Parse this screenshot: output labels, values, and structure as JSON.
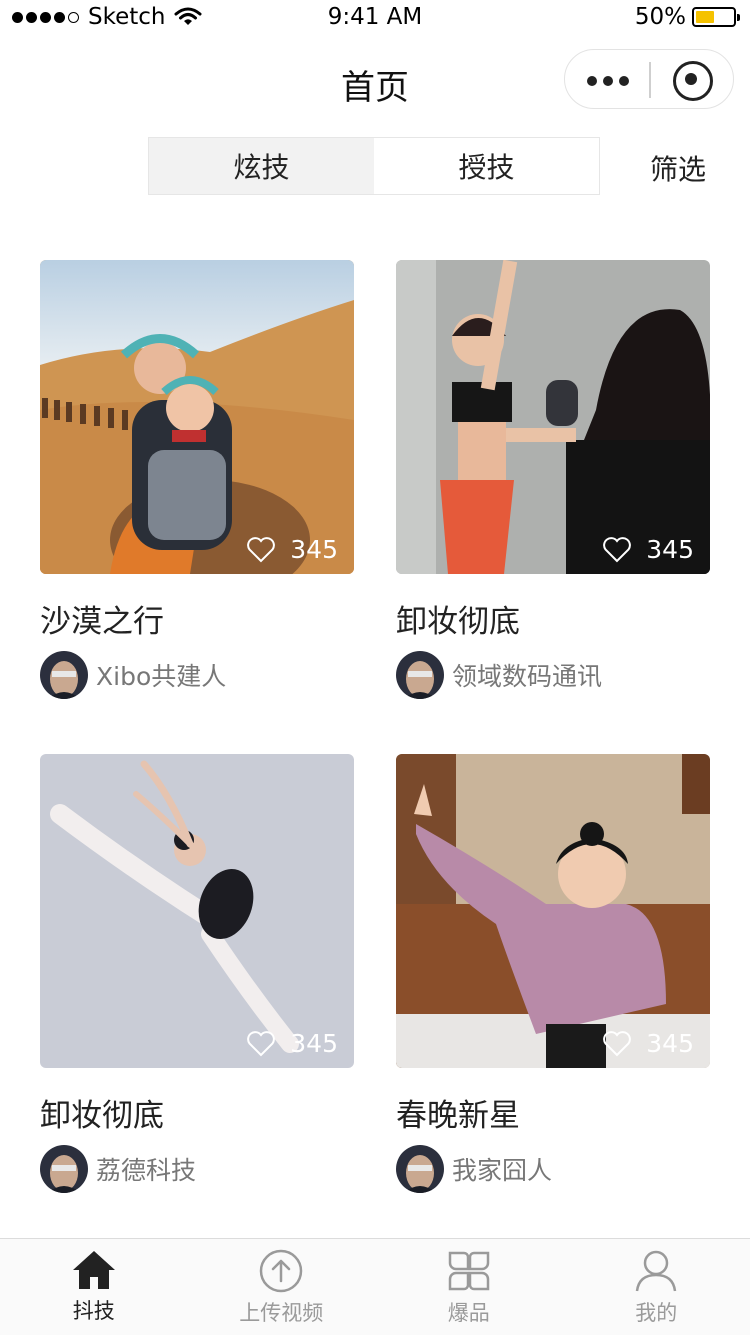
{
  "status_bar": {
    "carrier": "Sketch",
    "time": "9:41 AM",
    "battery": "50%",
    "battery_level": 0.5
  },
  "navbar": {
    "title": "首页"
  },
  "segmented": {
    "tabs": [
      "炫技",
      "授技"
    ],
    "active_index": 0,
    "filter_label": "筛选"
  },
  "feed": {
    "cards": [
      {
        "title": "沙漠之行",
        "author": "Xibo共建人",
        "likes": "345"
      },
      {
        "title": "卸妆彻底",
        "author": "领域数码通讯",
        "likes": "345"
      },
      {
        "title": "卸妆彻底",
        "author": "荔德科技",
        "likes": "345"
      },
      {
        "title": "春晚新星",
        "author": "我家囧人",
        "likes": "345"
      }
    ]
  },
  "tabbar": {
    "items": [
      {
        "label": "抖技",
        "icon": "home-icon",
        "active": true
      },
      {
        "label": "上传视频",
        "icon": "upload-icon",
        "active": false
      },
      {
        "label": "爆品",
        "icon": "grid-icon",
        "active": false
      },
      {
        "label": "我的",
        "icon": "user-icon",
        "active": false
      }
    ]
  },
  "colors": {
    "accent": "#222222",
    "inactive": "#9a9a9a",
    "battery": "#f5c200",
    "segment_active_bg": "#f2f2f2"
  }
}
